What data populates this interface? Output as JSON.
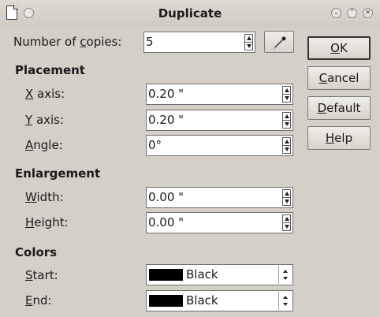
{
  "window": {
    "title": "Duplicate"
  },
  "copies": {
    "label_pre": "Number of ",
    "label_u": "c",
    "label_post": "opies:",
    "value": "5"
  },
  "placement": {
    "heading": "Placement",
    "x_axis": {
      "label_u": "X",
      "label_post": " axis:",
      "value": "0.20 \""
    },
    "y_axis": {
      "label_u": "Y",
      "label_post": " axis:",
      "value": "0.20 \""
    },
    "angle": {
      "label_u": "A",
      "label_post": "ngle:",
      "value": "0°"
    }
  },
  "enlargement": {
    "heading": "Enlargement",
    "width": {
      "label_u": "W",
      "label_post": "idth:",
      "value": "0.00 \""
    },
    "height": {
      "label_u": "H",
      "label_post": "eight:",
      "value": "0.00 \""
    }
  },
  "colors": {
    "heading": "Colors",
    "start": {
      "label_u": "S",
      "label_post": "tart:",
      "value": "Black",
      "swatch": "#000000"
    },
    "end": {
      "label_u": "E",
      "label_post": "nd:",
      "value": "Black",
      "swatch": "#000000"
    }
  },
  "buttons": {
    "ok": {
      "u": "O",
      "rest": "K"
    },
    "cancel": {
      "u": "C",
      "rest": "ancel"
    },
    "default": {
      "u": "D",
      "rest": "efault"
    },
    "help": {
      "u": "H",
      "rest": "elp"
    }
  },
  "icons": [
    "document-icon",
    "window-menu-icon",
    "minimize-icon",
    "maximize-icon",
    "close-icon",
    "pipette-icon"
  ]
}
